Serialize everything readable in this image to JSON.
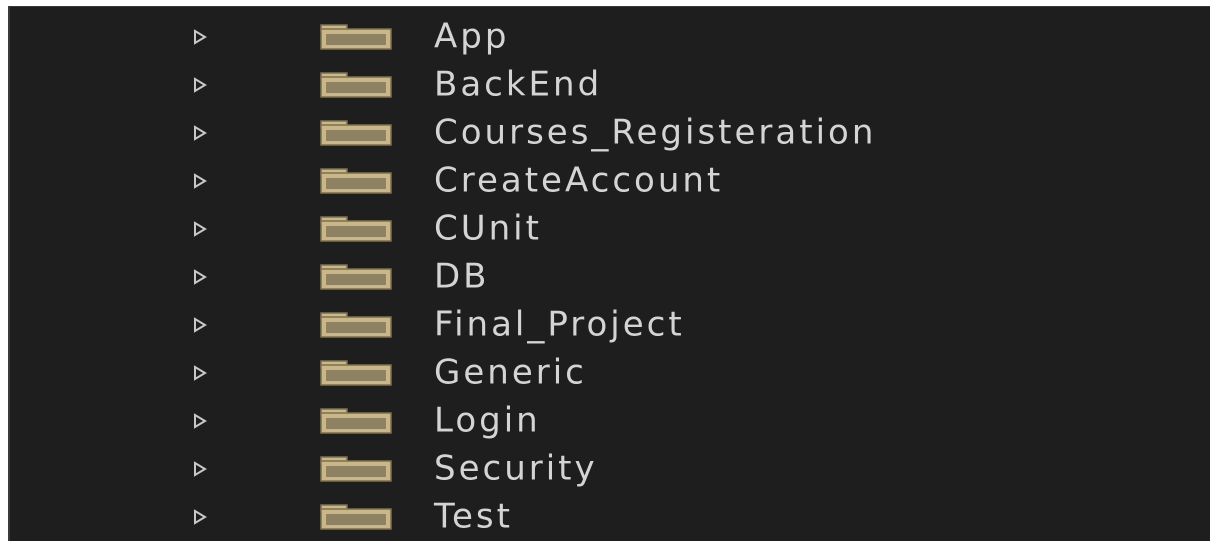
{
  "explorer": {
    "items": [
      {
        "label": "App",
        "icon": "folder-icon",
        "expander_icon": "chevron-right-icon"
      },
      {
        "label": "BackEnd",
        "icon": "folder-icon",
        "expander_icon": "chevron-right-icon"
      },
      {
        "label": "Courses_Registeration",
        "icon": "folder-icon",
        "expander_icon": "chevron-right-icon"
      },
      {
        "label": "CreateAccount",
        "icon": "folder-icon",
        "expander_icon": "chevron-right-icon"
      },
      {
        "label": "CUnit",
        "icon": "folder-icon",
        "expander_icon": "chevron-right-icon"
      },
      {
        "label": "DB",
        "icon": "folder-icon",
        "expander_icon": "chevron-right-icon"
      },
      {
        "label": "Final_Project",
        "icon": "folder-icon",
        "expander_icon": "chevron-right-icon"
      },
      {
        "label": "Generic",
        "icon": "folder-icon",
        "expander_icon": "chevron-right-icon"
      },
      {
        "label": "Login",
        "icon": "folder-icon",
        "expander_icon": "chevron-right-icon"
      },
      {
        "label": "Security",
        "icon": "folder-icon",
        "expander_icon": "chevron-right-icon"
      },
      {
        "label": "Test",
        "icon": "folder-icon",
        "expander_icon": "chevron-right-icon"
      }
    ]
  },
  "colors": {
    "background": "#1e1e1e",
    "text": "#d4d4d4",
    "folder_fill": "#c9b787",
    "folder_edge": "#7d7150",
    "expander": "#c8c8c8"
  }
}
